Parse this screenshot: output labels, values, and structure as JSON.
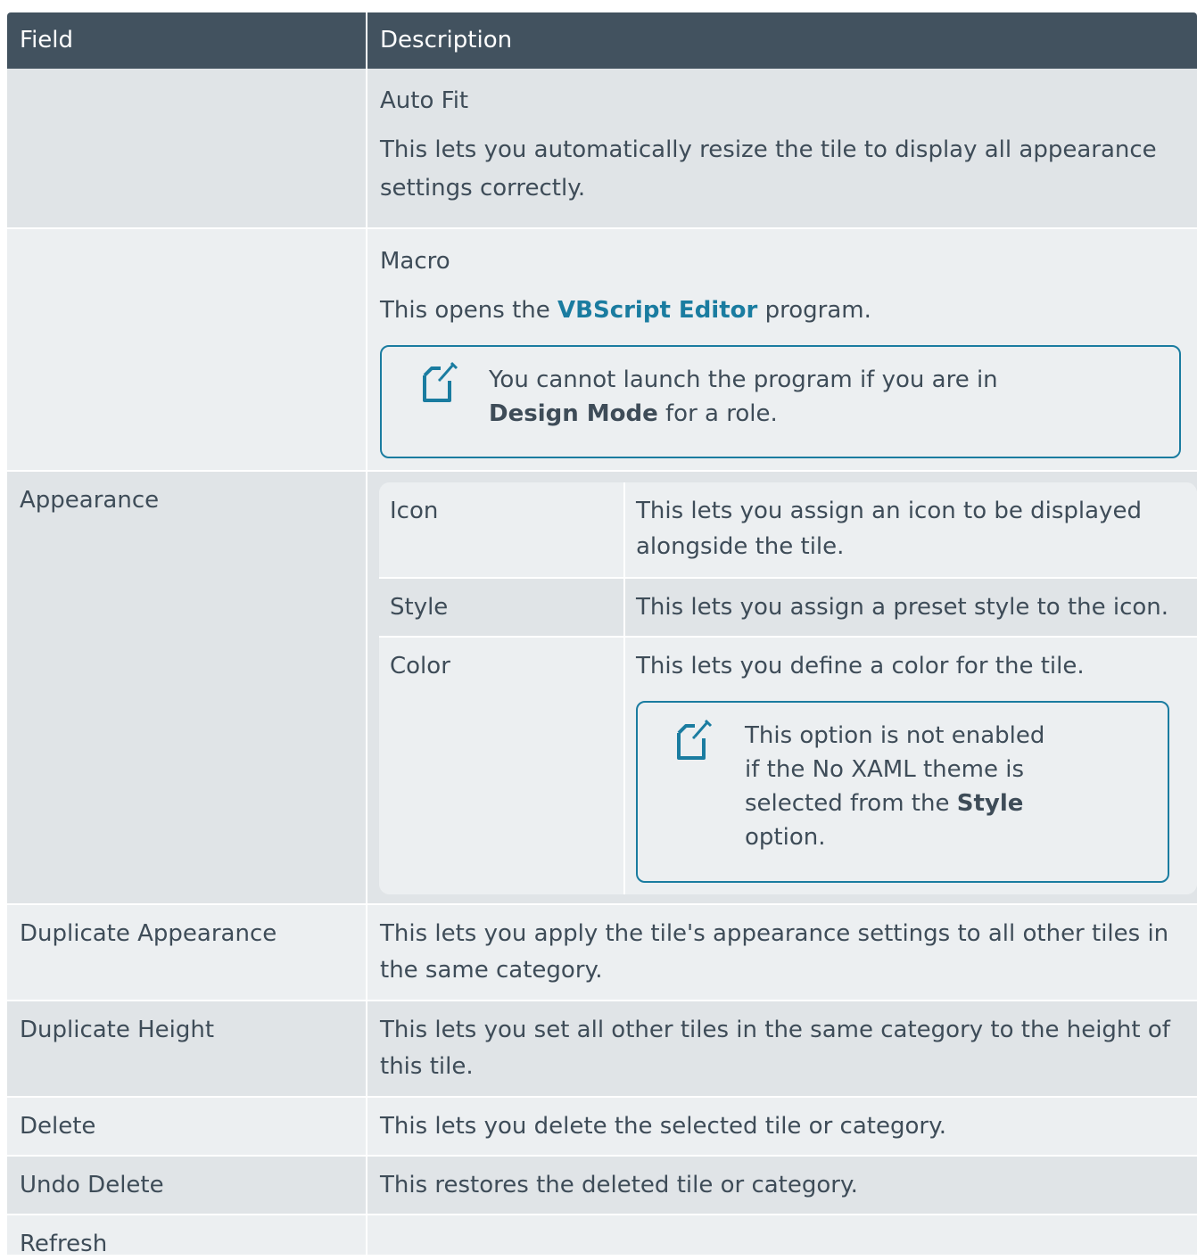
{
  "header": {
    "field": "Field",
    "description": "Description"
  },
  "rows": {
    "autofit": {
      "field": "",
      "title": "Auto Fit",
      "line1": "This lets you automatically resize the tile to display all appearance",
      "line2": "settings correctly."
    },
    "macro": {
      "field": "",
      "title": "Macro",
      "text_pre": "This opens the ",
      "link": "VBScript Editor",
      "text_post": " program.",
      "note_line1": "You cannot launch the program if you are in",
      "note_bold": "Design Mode",
      "note_rest": " for a role."
    },
    "appearance": {
      "field": "Appearance",
      "icon": {
        "label": "Icon",
        "desc1": "This lets you assign an icon to be displayed",
        "desc2": "alongside the tile."
      },
      "style": {
        "label": "Style",
        "desc": "This lets you assign a preset style to the icon."
      },
      "color": {
        "label": "Color",
        "desc": "This lets you define a color for the tile.",
        "note_l1": "This option is not enabled",
        "note_l2": "if the No XAML theme is",
        "note_l3_pre": "selected from the ",
        "note_l3_bold": "Style",
        "note_l4": "option."
      }
    },
    "dup_appearance": {
      "field": "Duplicate Appearance",
      "line1": "This lets you apply the tile's appearance settings to all other tiles in",
      "line2": "the same category."
    },
    "dup_height": {
      "field": "Duplicate Height",
      "line1": "This lets you set all other tiles in the same category to the height of",
      "line2": "this tile."
    },
    "delete": {
      "field": "Delete",
      "desc": "This lets you delete the selected tile or category."
    },
    "undo_delete": {
      "field": "Undo Delete",
      "desc": "This restores the deleted tile or category."
    },
    "refresh": {
      "field": "Refresh",
      "desc": ""
    }
  },
  "icons": {
    "note": "note-edit-icon"
  },
  "colors": {
    "header_bg": "#42525f",
    "row_light": "#eceff1",
    "row_dark": "#e0e4e7",
    "accent": "#1a7ca0",
    "text": "#3e4c58"
  }
}
